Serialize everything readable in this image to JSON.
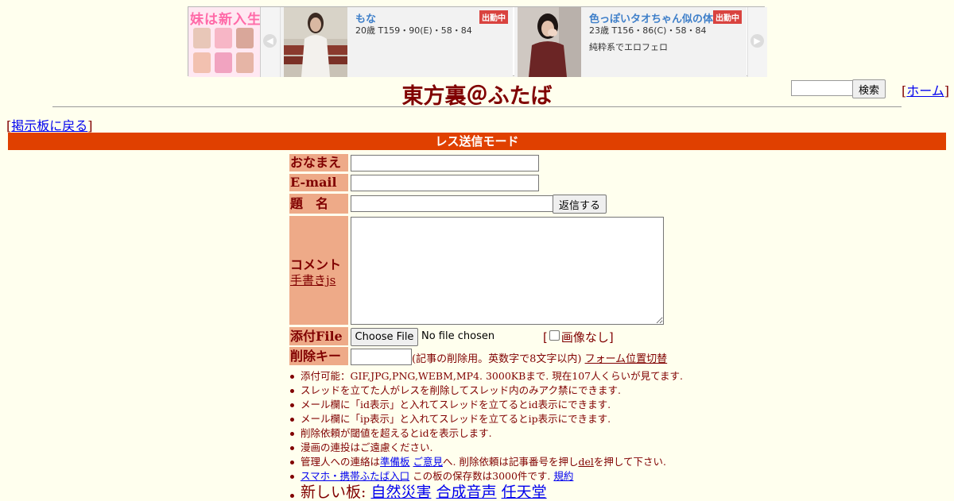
{
  "ad": {
    "collage_title": "妹は新入生",
    "cards": [
      {
        "name": "もな",
        "badge": "出勤中",
        "stats": "20歳 T159・90(E)・58・84",
        "desc": ""
      },
      {
        "name": "色っぽいタオちゃん似の体",
        "badge": "出勤中",
        "stats": "23歳 T156・86(C)・58・84",
        "desc": "純粋系でエロフェロ"
      }
    ]
  },
  "header": {
    "title": "東方裏＠ふたば",
    "search_button": "検索",
    "home_link": "ホーム"
  },
  "nav": {
    "back_link": "掲示板に戻る"
  },
  "mode_bar": "レス送信モード",
  "form": {
    "name_label": "おなまえ",
    "email_label": "E-mail",
    "subject_label": "題　名",
    "submit_button": "返信する",
    "comment_label": "コメント",
    "handwrite_link": "手書きjs",
    "file_label": "添付File",
    "choose_file_button": "Choose File",
    "file_status": "No file chosen",
    "no_image_label": "画像なし",
    "delkey_label": "削除キー",
    "delkey_note": "(記事の削除用。英数字で8文字以内)",
    "form_position_link": "フォーム位置切替"
  },
  "notes": {
    "n1": "添付可能：GIF,JPG,PNG,WEBM,MP4. 3000KBまで. 現在107人くらいが見てます.",
    "n2": "スレッドを立てた人がレスを削除してスレッド内のみアク禁にできます.",
    "n3": "メール欄に「id表示」と入れてスレッドを立てるとid表示にできます.",
    "n4": "メール欄に「ip表示」と入れてスレッドを立てるとip表示にできます.",
    "n5": "削除依頼が閾値を超えるとidを表示します.",
    "n6": "漫画の連投はご遠慮ください.",
    "n7_pre": "管理人への連絡は",
    "n7_link1": "準備板",
    "n7_link2": "ご意見",
    "n7_mid": "へ. 削除依頼は記事番号を押し",
    "n7_link3": "del",
    "n7_post": "を押して下さい.",
    "n8_link": "スマホ・携帯ふたば入口",
    "n8_mid": " この板の保存数は3000件です. ",
    "n8_link2": "規約",
    "n9_pre": "新しい板: ",
    "n9_links": [
      "自然災害",
      "合成音声",
      "任天堂"
    ]
  }
}
